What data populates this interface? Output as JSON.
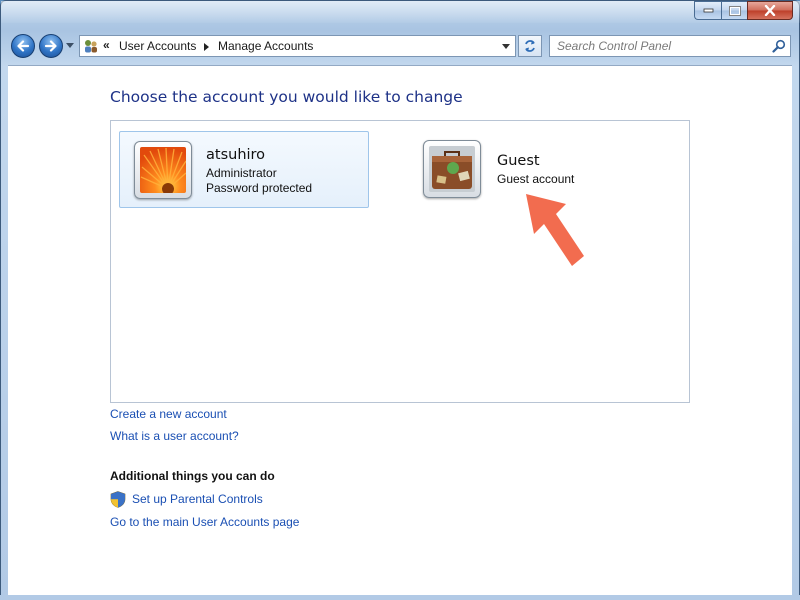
{
  "window": {
    "caption_buttons": [
      "minimize",
      "maximize",
      "close"
    ],
    "accent": "#2f74c6"
  },
  "nav": {
    "breadcrumb_prefix": "«",
    "breadcrumb": [
      "User Accounts",
      "Manage Accounts"
    ],
    "search_placeholder": "Search Control Panel"
  },
  "main": {
    "heading": "Choose the account you would like to change",
    "accounts": [
      {
        "name": "atsuhiro",
        "lines": [
          "Administrator",
          "Password protected"
        ],
        "picture": "orange-flower-picture",
        "selected": true
      },
      {
        "name": "Guest",
        "lines": [
          "Guest account"
        ],
        "picture": "suitcase-picture",
        "selected": false
      }
    ],
    "links": [
      "Create a new account",
      "What is a user account?"
    ],
    "additional": {
      "title": "Additional things you can do",
      "items": [
        "Set up Parental Controls",
        "Go to the main User Accounts page"
      ]
    }
  },
  "annotation": {
    "arrow_color": "#f26c4f",
    "points_to": "Guest"
  }
}
